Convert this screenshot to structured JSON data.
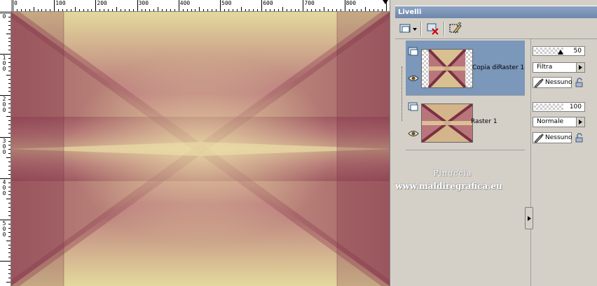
{
  "canvas": {
    "ruler_top_labels": [
      "0",
      "100",
      "200",
      "300",
      "400",
      "500",
      "600",
      "700",
      "800"
    ],
    "ruler_left_labels": [
      "0",
      "100",
      "200",
      "300",
      "400",
      "500"
    ],
    "image_colors": {
      "light": "#e5dc9e",
      "dark": "#8a3a4e",
      "mid": "#b8767a"
    }
  },
  "palette": {
    "title": "Livelli",
    "toolbar": {
      "new_layer_icon": "new-raster-layer-icon",
      "delete_icon": "delete-layer-icon",
      "edit_icon": "edit-selection-icon"
    },
    "layers": [
      {
        "name": "Copia diRaster 1",
        "selected": true,
        "opacity": "50",
        "opacity_level": 0.5,
        "blend_mode": "Filtra",
        "mask": "Nessuno"
      },
      {
        "name": "Raster 1",
        "selected": false,
        "opacity": "100",
        "opacity_level": 1.0,
        "blend_mode": "Normale",
        "mask": "Nessuno"
      }
    ],
    "watermark": {
      "line1": "Pinuccia",
      "line2": "www.maldiregrafica.eu"
    },
    "accent": "#7b97ba"
  }
}
